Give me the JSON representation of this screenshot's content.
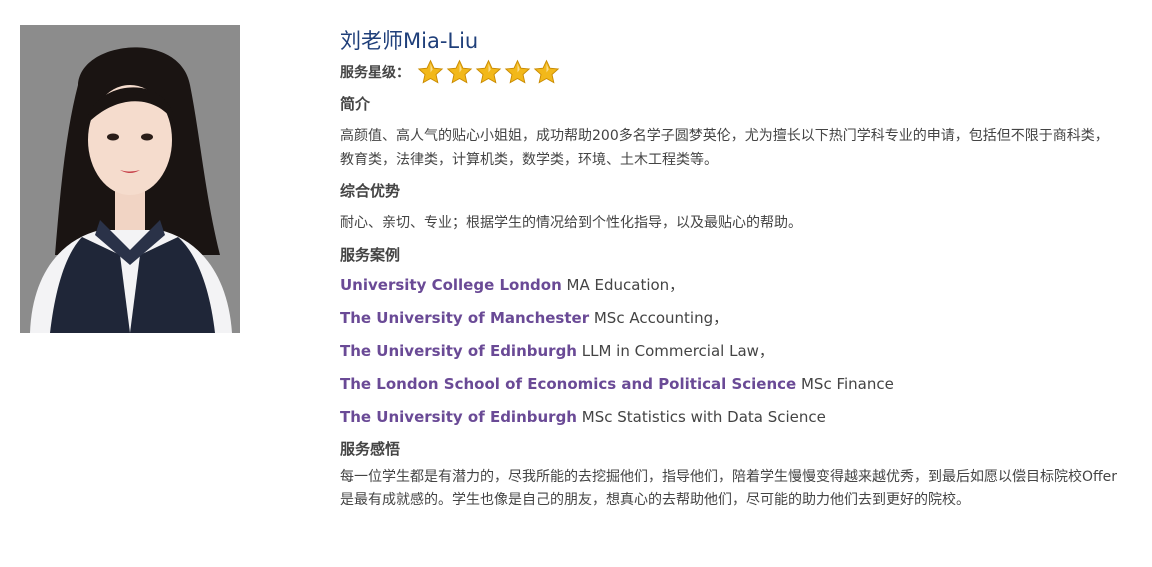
{
  "profile": {
    "name": "刘老师Mia-Liu",
    "rating_label": "服务星级：",
    "rating": 5,
    "rating_max": 5,
    "star_color": "#f2b81a"
  },
  "sections": {
    "intro": {
      "title": "简介",
      "text": "高颜值、高人气的贴心小姐姐，成功帮助200多名学子圆梦英伦，尤为擅长以下热门学科专业的申请，包括但不限于商科类，教育类，法律类，计算机类，数学类，环境、土木工程类等。"
    },
    "advantages": {
      "title": "综合优势",
      "text": "耐心、亲切、专业；根据学生的情况给到个性化指导，以及最贴心的帮助。"
    },
    "cases": {
      "title": "服务案例",
      "items": [
        {
          "university": "University College London",
          "program": " MA Education，"
        },
        {
          "university": "The University of Manchester",
          "program": " MSc Accounting，"
        },
        {
          "university": "The University of Edinburgh",
          "program": " LLM in Commercial Law，"
        },
        {
          "university": "The London School of Economics and Political Science",
          "program": " MSc Finance"
        },
        {
          "university": "The University of Edinburgh",
          "program": " MSc Statistics with Data Science"
        }
      ]
    },
    "reflection": {
      "title": "服务感悟",
      "text": "每一位学生都是有潜力的，尽我所能的去挖掘他们，指导他们，陪着学生慢慢变得越来越优秀，到最后如愿以偿目标院校Offer是最有成就感的。学生也像是自己的朋友，想真心的去帮助他们，尽可能的助力他们去到更好的院校。"
    }
  },
  "colors": {
    "name": "#1f3f7a",
    "university": "#6a4a96",
    "text": "#444444"
  }
}
